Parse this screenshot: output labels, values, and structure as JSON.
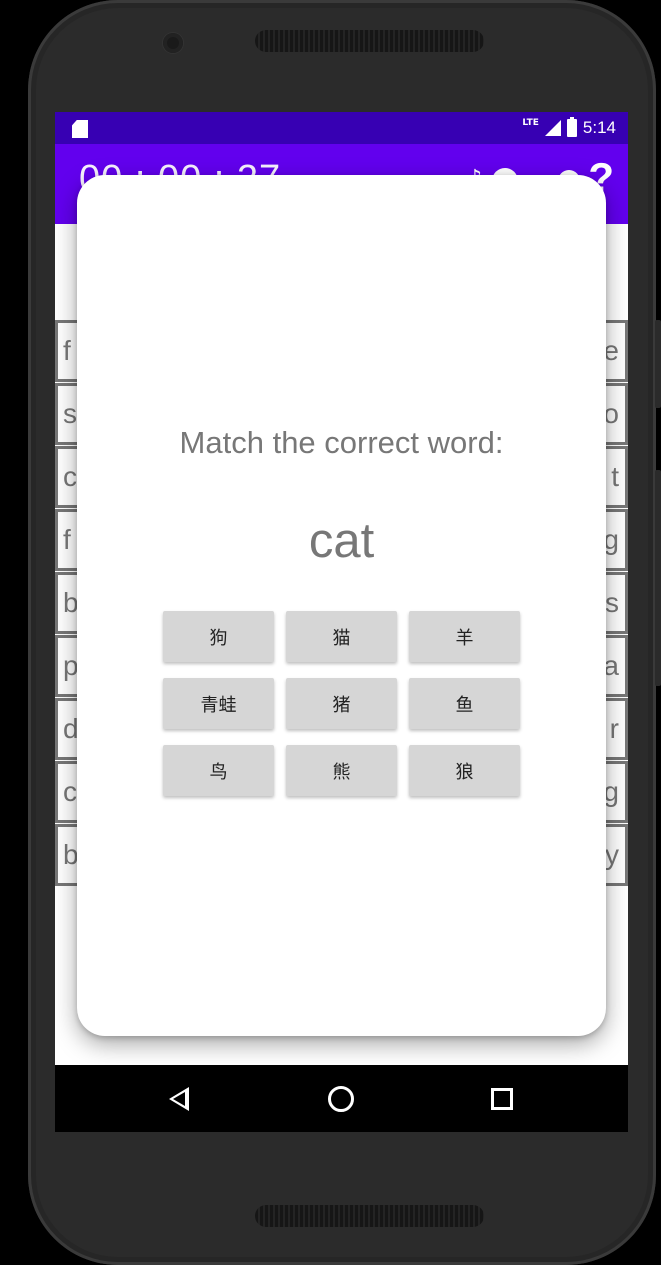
{
  "status_bar": {
    "network": "LTE",
    "time": "5:14"
  },
  "app_bar": {
    "timer": "00 : 00 : 27",
    "help_label": "?"
  },
  "word_grid": {
    "rows": [
      {
        "left": "f",
        "right": "e"
      },
      {
        "left": "s",
        "right": "o"
      },
      {
        "left": "c",
        "right": "t"
      },
      {
        "left": "f",
        "right": "g"
      },
      {
        "left": "b",
        "right": "s"
      },
      {
        "left": "p",
        "right": "a"
      },
      {
        "left": "d",
        "right": "r"
      },
      {
        "left": "c",
        "right": "g"
      },
      {
        "left": "b",
        "right": "y"
      }
    ]
  },
  "dialog": {
    "prompt": "Match the correct word:",
    "word": "cat",
    "options": [
      "狗",
      "猫",
      "羊",
      "青蛙",
      "猪",
      "鱼",
      "鸟",
      "熊",
      "狼"
    ]
  },
  "colors": {
    "status_bar": "#3700b3",
    "app_bar": "#6200ee",
    "option_button": "#d6d6d6",
    "text_gray": "#777777"
  },
  "icons": {
    "nav": [
      "back-icon",
      "home-icon",
      "recent-apps-icon"
    ],
    "status": [
      "sd-card-icon",
      "signal-icon",
      "battery-charging-icon"
    ]
  }
}
